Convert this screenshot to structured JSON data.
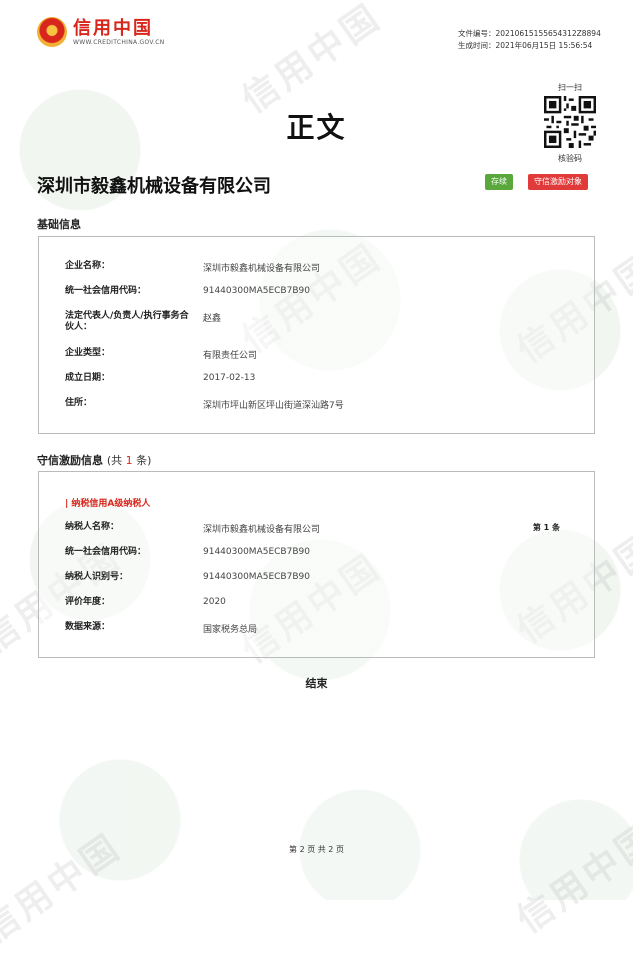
{
  "header": {
    "logo_text": "信用中国",
    "logo_url": "WWW.CREDITCHINA.GOV.CN",
    "file_no_label": "文件编号：",
    "file_no": "20210615155654312Z8894",
    "generated_label": "生成时间：",
    "generated_time": "2021年06月15日 15:56:54",
    "qr_top": "扫一扫",
    "qr_bottom": "核验码"
  },
  "title": "正文",
  "company": {
    "name": "深圳市毅鑫机械设备有限公司",
    "badge_green": "存续",
    "badge_red": "守信激励对象"
  },
  "basic_info": {
    "section_title": "基础信息",
    "rows": [
      {
        "label": "企业名称：",
        "value": "深圳市毅鑫机械设备有限公司"
      },
      {
        "label": "统一社会信用代码：",
        "value": "91440300MA5ECB7B90"
      },
      {
        "label": "法定代表人/负责人/执行事务合伙人：",
        "value": "赵鑫"
      },
      {
        "label": "企业类型：",
        "value": "有限责任公司"
      },
      {
        "label": "成立日期：",
        "value": "2017-02-13"
      },
      {
        "label": "住所：",
        "value": "深圳市坪山新区坪山街道深汕路7号"
      }
    ]
  },
  "incentive_info": {
    "section_title": "守信激励信息",
    "count_prefix": "(共 ",
    "count": "1",
    "count_suffix": " 条)",
    "sub_title": "| 纳税信用A级纳税人",
    "page_no": "第 1 条",
    "rows": [
      {
        "label": "纳税人名称：",
        "value": "深圳市毅鑫机械设备有限公司"
      },
      {
        "label": "统一社会信用代码：",
        "value": "91440300MA5ECB7B90"
      },
      {
        "label": "纳税人识别号：",
        "value": "91440300MA5ECB7B90"
      },
      {
        "label": "评价年度：",
        "value": "2020"
      },
      {
        "label": "数据来源：",
        "value": "国家税务总局"
      }
    ]
  },
  "end_text": "结束",
  "footer": "第 2 页  共 2 页",
  "watermark": "信用中国",
  "colors": {
    "brand_red": "#d8261c",
    "badge_green": "#5aa83c",
    "badge_red": "#e03a3a"
  }
}
